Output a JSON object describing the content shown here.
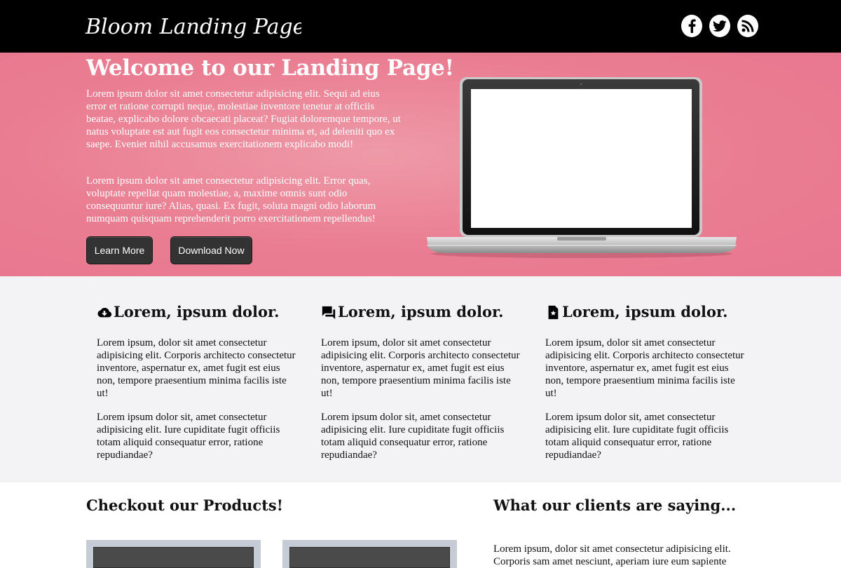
{
  "header": {
    "logo_text": "Bloom Landing Page",
    "social": [
      {
        "name": "facebook-icon"
      },
      {
        "name": "twitter-icon"
      },
      {
        "name": "rss-icon"
      }
    ]
  },
  "hero": {
    "title": "Welcome to our Landing Page!",
    "paragraph1": "Lorem ipsum dolor sit amet consectetur adipisicing elit. Sequi ad eius error et ratione corrupti neque, molestiae inventore tenetur at officiis beatae, explicabo dolore obcaecati placeat? Fugiat doloremque tempore, ut natus voluptate est aut fugit eos consectetur minima et, ad deleniti quo ex saepe. Eveniet nihil accusamus exercitationem explicabo modi!",
    "paragraph2": "Lorem ipsum dolor sit amet consectetur adipisicing elit. Error quas, voluptate repellat quam molestiae, a, maxime omnis sunt odio consequuntur iure? Alias, quasi. Ex fugit, soluta magni odio laborum numquam quisquam reprehenderit porro exercitationem repellendus!",
    "learn_more_label": "Learn More",
    "download_label": "Download Now"
  },
  "features": [
    {
      "icon": "cloud-download-icon",
      "title": "Lorem, ipsum dolor.",
      "p1": "Lorem ipsum, dolor sit amet consectetur adipisicing elit. Corporis architecto consectetur inventore, aspernatur ex, amet fugit est eius non, tempore praesentium minima facilis iste ut!",
      "p2": "Lorem ipsum dolor sit, amet consectetur adipisicing elit. Iure cupiditate fugit officiis totam aliquid consequatur error, ratione repudiandae?"
    },
    {
      "icon": "chat-bubbles-icon",
      "title": "Lorem, ipsum dolor.",
      "p1": "Lorem ipsum, dolor sit amet consectetur adipisicing elit. Corporis architecto consectetur inventore, aspernatur ex, amet fugit est eius non, tempore praesentium minima facilis iste ut!",
      "p2": "Lorem ipsum dolor sit, amet consectetur adipisicing elit. Iure cupiditate fugit officiis totam aliquid consequatur error, ratione repudiandae?"
    },
    {
      "icon": "file-star-icon",
      "title": "Lorem, ipsum dolor.",
      "p1": "Lorem ipsum, dolor sit amet consectetur adipisicing elit. Corporis architecto consectetur inventore, aspernatur ex, amet fugit est eius non, tempore praesentium minima facilis iste ut!",
      "p2": "Lorem ipsum dolor sit, amet consectetur adipisicing elit. Iure cupiditate fugit officiis totam aliquid consequatur error, ratione repudiandae?"
    }
  ],
  "products": {
    "title": "Checkout our Products!"
  },
  "clients": {
    "title": "What our clients are saying...",
    "testimonial": "Lorem ipsum, dolor sit amet consectetur adipisicing elit. Corporis sam amet nesciunt, aperiam iure eum sapiente"
  },
  "colors": {
    "header_bg": "#000000",
    "hero_bg": "#e87a8f",
    "button_bg": "#333333",
    "features_bg": "#f3f3f5"
  }
}
